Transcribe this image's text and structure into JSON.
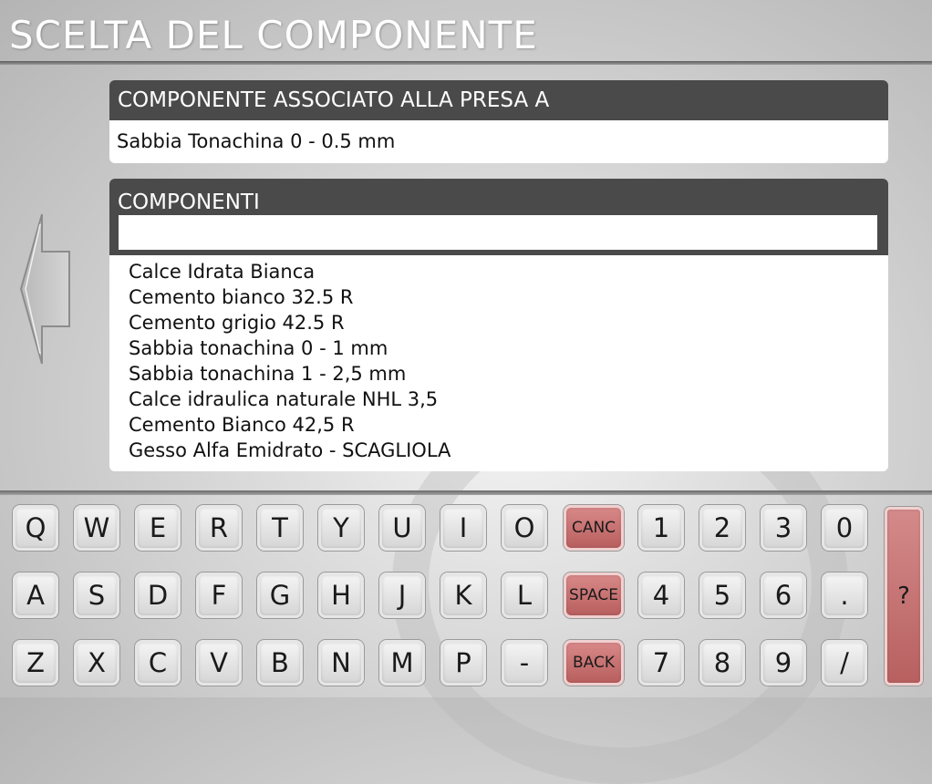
{
  "header": {
    "title": "SCELTA DEL COMPONENTE"
  },
  "associated": {
    "label": "COMPONENTE ASSOCIATO ALLA PRESA A",
    "value": "Sabbia Tonachina 0 - 0.5 mm"
  },
  "components": {
    "label": "COMPONENTI",
    "search": {
      "value": "",
      "placeholder": ""
    },
    "items": [
      "Calce Idrata Bianca",
      "Cemento bianco 32.5 R",
      "Cemento grigio 42.5 R",
      "Sabbia tonachina 0 - 1 mm",
      "Sabbia tonachina 1 - 2,5 mm",
      "Calce idraulica naturale NHL 3,5",
      "Cemento Bianco 42,5 R",
      "Gesso Alfa Emidrato - SCAGLIOLA"
    ]
  },
  "navigation": {
    "back_icon": "arrow-left-icon"
  },
  "keyboard": {
    "row1": [
      "Q",
      "W",
      "E",
      "R",
      "T",
      "Y",
      "U",
      "I",
      "O"
    ],
    "row2": [
      "A",
      "S",
      "D",
      "F",
      "G",
      "H",
      "J",
      "K",
      "L"
    ],
    "row3": [
      "Z",
      "X",
      "C",
      "V",
      "B",
      "N",
      "M",
      "P",
      "-"
    ],
    "canc": "CANC",
    "space": "SPACE",
    "back": "BACK",
    "num1": [
      "1",
      "2",
      "3",
      "0"
    ],
    "num2": [
      "4",
      "5",
      "6",
      "."
    ],
    "num3": [
      "7",
      "8",
      "9",
      "/"
    ],
    "help": "?"
  },
  "colors": {
    "header_bg": "#4a4a4a",
    "accent_red": "#c46c6c"
  }
}
